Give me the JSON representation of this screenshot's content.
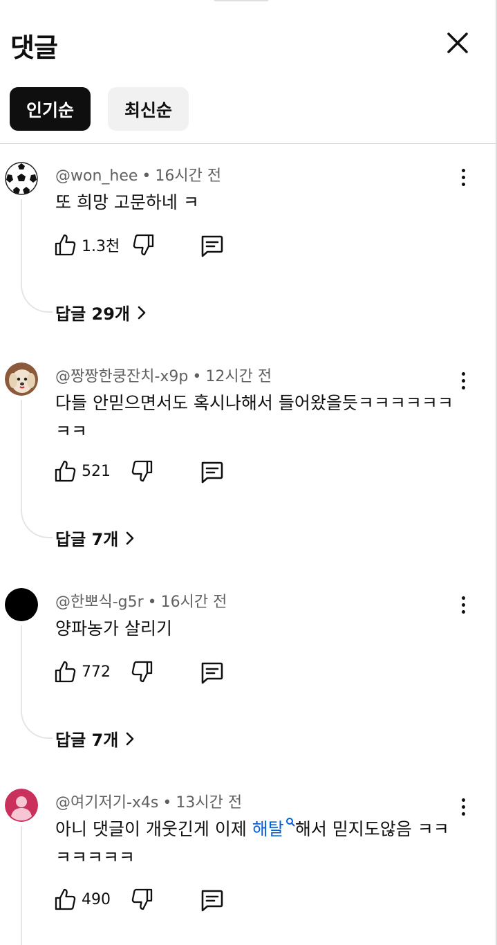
{
  "header": {
    "title": "댓글"
  },
  "chips": [
    {
      "label": "인기순",
      "active": true
    },
    {
      "label": "최신순",
      "active": false
    }
  ],
  "comments": [
    {
      "author": "@won_hee",
      "time": "16시간 전",
      "text": "또 희망 고문하네 ㅋ",
      "likes": "1.3천",
      "replies_label": "답글 29개",
      "avatar_icon": "soccer-ball-avatar"
    },
    {
      "author": "@짱짱한쿵잔치-x9p",
      "time": "12시간 전",
      "text": "다들 안믿으면서도 혹시나해서 들어왔을듯ㅋㅋㅋㅋㅋㅋㅋㅋ",
      "likes": "521",
      "replies_label": "답글 7개",
      "avatar_icon": "dog-photo-avatar"
    },
    {
      "author": "@한뽀식-g5r",
      "time": "16시간 전",
      "text": "양파농가 살리기",
      "likes": "772",
      "replies_label": "답글 7개",
      "avatar_icon": "black-circle-avatar"
    },
    {
      "author": "@여기저기-x4s",
      "time": "13시간 전",
      "text_before": "아니 댓글이 개웃긴게 이제 ",
      "link": "해탈",
      "text_after": "해서 믿지도않음 ㅋㅋㅋㅋㅋㅋㅋ",
      "likes": "490",
      "avatar_icon": "default-user-avatar"
    }
  ],
  "colors": {
    "link": "#065fd4",
    "meta": "#606060",
    "avatar_default": "#c9305b"
  }
}
